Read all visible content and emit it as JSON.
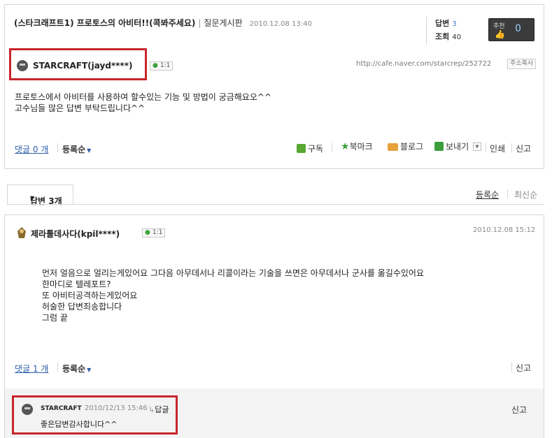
{
  "post": {
    "title": "(스타크래프트1) 프로토스의 아비터!!(콕봐주세요)",
    "board": "질문게시판",
    "date": "2010.12.08 13:40",
    "answers_label": "답변",
    "answers_count": "3",
    "views_label": "조회",
    "views_count": "40",
    "recommend_label": "추천",
    "recommend_count": "0",
    "author": "STARCRAFT(jayd****)",
    "chat_badge": "1:1",
    "url": "http://cafe.naver.com/starcrep/252722",
    "copy_label": "주소복사",
    "body": [
      "프로토스에서 아비터를 사용하여 할수있는 기능 및 방법이 궁금해요오^^",
      "고수님들 많은 답변 부탁드립니다^^"
    ],
    "comments_link": "댓글 0 개",
    "sort_label": "등록순",
    "tools": {
      "subscribe": "구독",
      "bookmark": "북마크",
      "blog": "블로그",
      "send": "보내기",
      "print": "인쇄",
      "report": "신고"
    }
  },
  "answers_tab": {
    "label": "답변 3개",
    "sort_register": "등록순",
    "sort_latest": "최신순"
  },
  "answer": {
    "author": "제라툴데사다(kpil****)",
    "chat_badge": "1:1",
    "date": "2010.12.08 15:12",
    "body": [
      "먼저 얼음으로 얼리는게있어요 그다음 아무데서나 리콜이라는 기술을 쓰면은 아무데서나 군사를 옮길수있어요",
      "한마디로 텔레포트?",
      "또 아비터공격하는게있어요",
      "허술한 답변죄송합니다",
      "그럼 끝"
    ],
    "comments_link": "댓글 1 개",
    "sort_label": "등록순",
    "report": "신고"
  },
  "reply": {
    "author": "STARCRAFT",
    "date": "2010/12/13 15:46",
    "reply_label": "답글",
    "text": "좋은답변감사합니다^^",
    "report": "신고"
  },
  "colors": {
    "highlight_box": "#c8262b",
    "link_blue": "#2c5ea8"
  }
}
